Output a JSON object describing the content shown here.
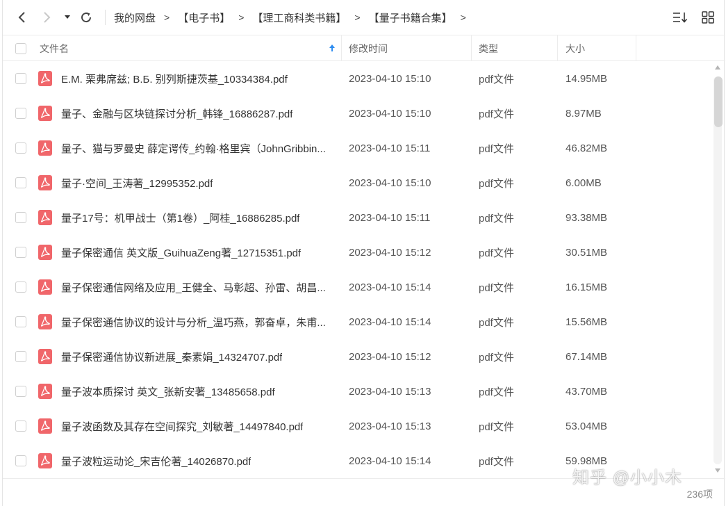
{
  "breadcrumb": [
    "我的网盘",
    "【电子书】",
    "【理工商科类书籍】",
    "【量子书籍合集】"
  ],
  "crumb_sep": ">",
  "columns": {
    "name": "文件名",
    "time": "修改时间",
    "type": "类型",
    "size": "大小"
  },
  "files": [
    {
      "name": "E.M. 栗弗席兹; B.Б. 别列斯捷茨基_10334384.pdf",
      "time": "2023-04-10 15:10",
      "type": "pdf文件",
      "size": "14.95MB"
    },
    {
      "name": "量子、金融与区块链探讨分析_韩锋_16886287.pdf",
      "time": "2023-04-10 15:10",
      "type": "pdf文件",
      "size": "8.97MB"
    },
    {
      "name": "量子、猫与罗曼史  薛定谔传_约翰·格里宾（JohnGribbin...",
      "time": "2023-04-10 15:11",
      "type": "pdf文件",
      "size": "46.82MB"
    },
    {
      "name": "量子·空间_王涛著_12995352.pdf",
      "time": "2023-04-10 15:10",
      "type": "pdf文件",
      "size": "6.00MB"
    },
    {
      "name": "量子17号：机甲战士（第1卷）_阿桂_16886285.pdf",
      "time": "2023-04-10 15:11",
      "type": "pdf文件",
      "size": "93.38MB"
    },
    {
      "name": "量子保密通信  英文版_GuihuaZeng著_12715351.pdf",
      "time": "2023-04-10 15:12",
      "type": "pdf文件",
      "size": "30.51MB"
    },
    {
      "name": "量子保密通信网络及应用_王健全、马彰超、孙雷、胡昌...",
      "time": "2023-04-10 15:14",
      "type": "pdf文件",
      "size": "16.15MB"
    },
    {
      "name": "量子保密通信协议的设计与分析_温巧燕，郭奋卓，朱甫...",
      "time": "2023-04-10 15:14",
      "type": "pdf文件",
      "size": "15.56MB"
    },
    {
      "name": "量子保密通信协议新进展_秦素娟_14324707.pdf",
      "time": "2023-04-10 15:12",
      "type": "pdf文件",
      "size": "67.14MB"
    },
    {
      "name": "量子波本质探讨  英文_张新安著_13485658.pdf",
      "time": "2023-04-10 15:13",
      "type": "pdf文件",
      "size": "43.70MB"
    },
    {
      "name": "量子波函数及其存在空间探究_刘敏著_14497840.pdf",
      "time": "2023-04-10 15:13",
      "type": "pdf文件",
      "size": "53.04MB"
    },
    {
      "name": "量子波粒运动论_宋吉伦著_14026870.pdf",
      "time": "2023-04-10 15:14",
      "type": "pdf文件",
      "size": "59.98MB"
    }
  ],
  "scroll": {
    "position": 0.0,
    "visible_fraction": 0.13
  },
  "item_count": "236项",
  "watermark": "知乎 @小小木",
  "colors": {
    "pdf_icon": "#f0666a",
    "sort_arrow": "#2d8cf0"
  }
}
